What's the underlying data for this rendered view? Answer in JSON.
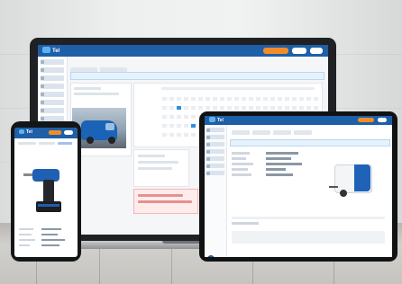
{
  "scene": {
    "description_devices": [
      "laptop",
      "tablet",
      "phone"
    ]
  },
  "laptop": {
    "app_logo": "Tel",
    "accent_color": "#1e5fa8",
    "alert_color": "#e6f2fb",
    "highlight_color": "#f28c28"
  },
  "tablet": {
    "app_logo": "Tel"
  },
  "phone": {
    "app_logo": "Tel"
  }
}
